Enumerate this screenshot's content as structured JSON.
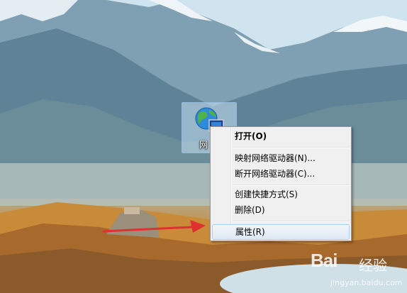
{
  "desktop_icon": {
    "label": "网",
    "icon": "network-globe-icon"
  },
  "context_menu": {
    "items": [
      {
        "label": "打开(O)",
        "bold": true
      },
      {
        "label": "映射网络驱动器(N)..."
      },
      {
        "label": "断开网络驱动器(C)..."
      },
      {
        "label": "创建快捷方式(S)"
      },
      {
        "label": "删除(D)"
      },
      {
        "label": "属性(R)",
        "highlighted": true
      }
    ]
  },
  "annotation": {
    "arrow_color": "#e03030"
  },
  "watermark": {
    "brand": "Bai",
    "brand_suffix": "经验",
    "url": "jingyan.baidu.com"
  }
}
